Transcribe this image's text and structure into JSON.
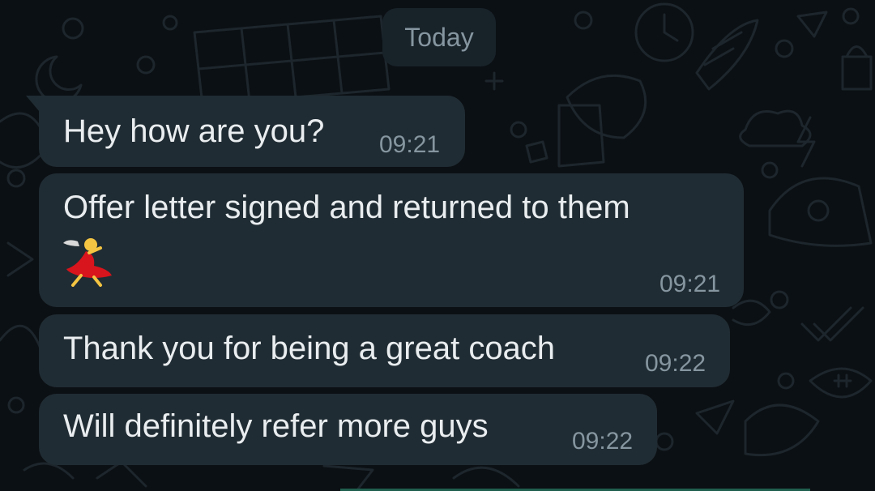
{
  "date_divider": "Today",
  "messages": [
    {
      "text": "Hey how are you?",
      "time": "09:21"
    },
    {
      "text": "Offer letter signed and returned to them",
      "emoji": "dancer-emoji",
      "time": "09:21"
    },
    {
      "text": "Thank you for being a great coach",
      "time": "09:22"
    },
    {
      "text": "Will definitely refer more guys",
      "time": "09:22"
    }
  ],
  "colors": {
    "background": "#0b1014",
    "bubble": "#202c33",
    "message_text": "#e9edef",
    "timestamp_text": "#8696a0",
    "date_chip": "#182229"
  }
}
